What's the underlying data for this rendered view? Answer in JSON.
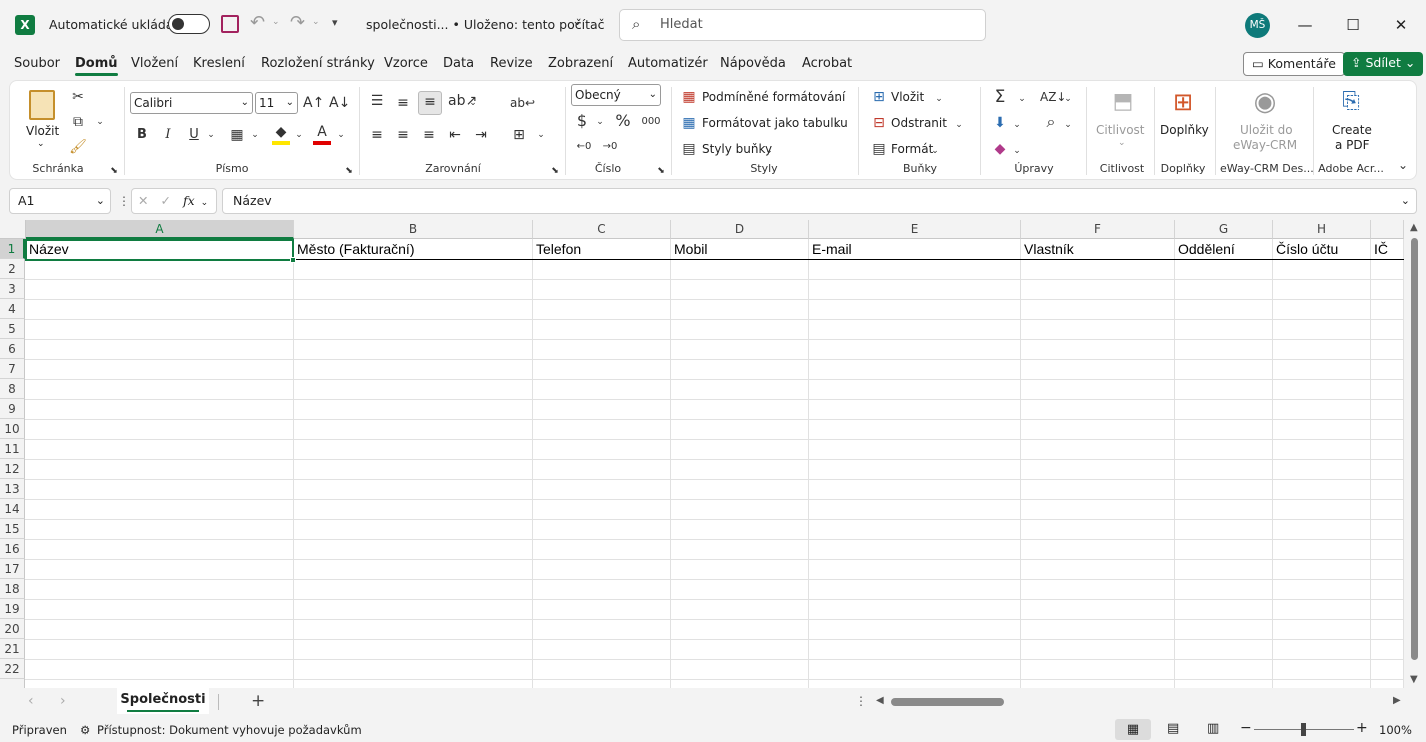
{
  "titlebar": {
    "autosave_label": "Automatické ukládání",
    "file_title": "společnosti... • Uloženo: tento počítač",
    "search_placeholder": "Hledat",
    "user_initials": "MŠ"
  },
  "tabs": [
    "Soubor",
    "Domů",
    "Vložení",
    "Kreslení",
    "Rozložení stránky",
    "Vzorce",
    "Data",
    "Revize",
    "Zobrazení",
    "Automatizér",
    "Nápověda",
    "Acrobat"
  ],
  "actions": {
    "comments": "Komentáře",
    "share": "Sdílet"
  },
  "ribbon": {
    "clipboard": {
      "paste": "Vložit",
      "label": "Schránka"
    },
    "font": {
      "name": "Calibri",
      "size": "11",
      "bold": "B",
      "italic": "I",
      "underline": "U",
      "label": "Písmo"
    },
    "alignment": {
      "label": "Zarovnání"
    },
    "number": {
      "format": "Obecný",
      "label": "Číslo"
    },
    "styles": {
      "conditional": "Podmíněné formátování",
      "table": "Formátovat jako tabulku",
      "cell": "Styly buňky",
      "label": "Styly"
    },
    "cells": {
      "insert": "Vložit",
      "delete": "Odstranit",
      "format": "Formát",
      "label": "Buňky"
    },
    "editing": {
      "label": "Úpravy"
    },
    "sensitivity": {
      "button": "Citlivost",
      "label": "Citlivost"
    },
    "addins": {
      "button": "Doplňky",
      "label": "Doplňky"
    },
    "eway": {
      "button_line1": "Uložit do",
      "button_line2": "eWay-CRM",
      "label": "eWay-CRM Des..."
    },
    "acrobat": {
      "button_line1": "Create",
      "button_line2": "a PDF",
      "label": "Adobe Acr..."
    }
  },
  "formula_bar": {
    "name_box": "A1",
    "content": "Název",
    "fx": "fx"
  },
  "sheet": {
    "columns": [
      "A",
      "B",
      "C",
      "D",
      "E",
      "F",
      "G",
      "H"
    ],
    "rows": [
      "1",
      "2",
      "3",
      "4",
      "5",
      "6",
      "7",
      "8",
      "9",
      "10",
      "11",
      "12",
      "13",
      "14",
      "15",
      "16",
      "17",
      "18",
      "19",
      "20",
      "21",
      "22"
    ],
    "row1": [
      "Název",
      "Město (Fakturační)",
      "Telefon",
      "Mobil",
      "E-mail",
      "Vlastník",
      "Oddělení",
      "Číslo účtu",
      "IČ"
    ]
  },
  "sheet_tabs": {
    "active": "Společnosti"
  },
  "status": {
    "ready": "Připraven",
    "accessibility": "Přístupnost: Dokument vyhovuje požadavkům",
    "zoom": "100%"
  }
}
